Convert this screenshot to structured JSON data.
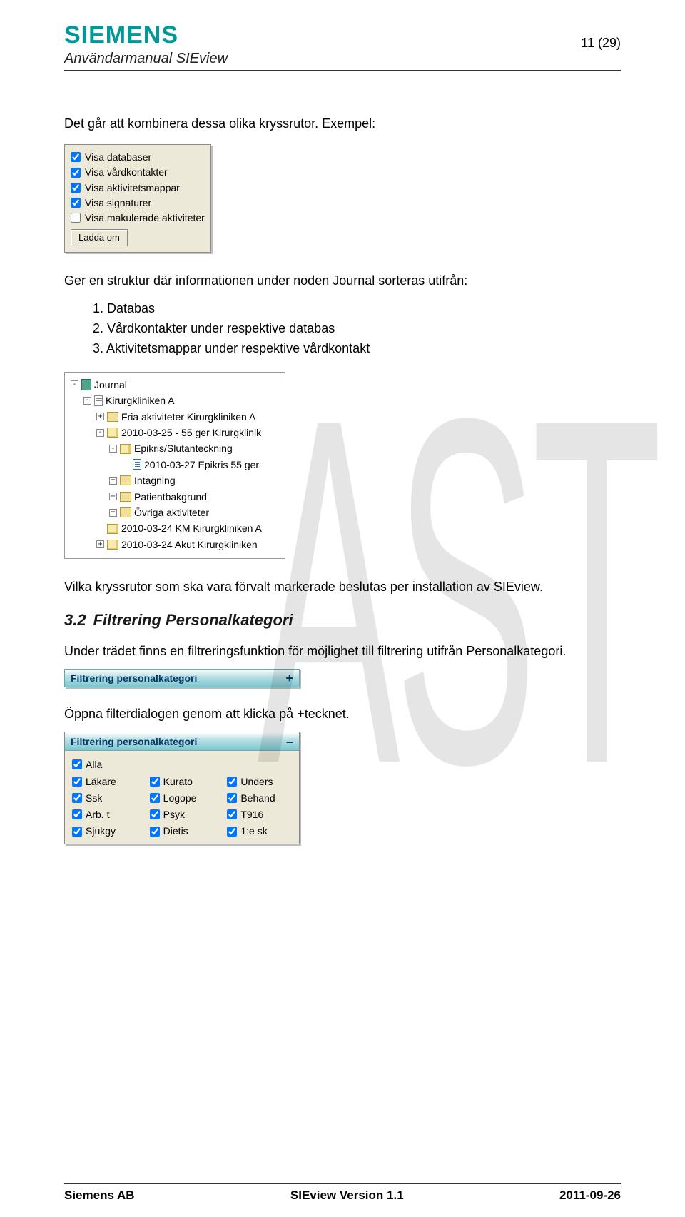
{
  "header": {
    "logo": "SIEMENS",
    "manual_title": "Användarmanual SIEview",
    "page_num": "11 (29)"
  },
  "watermark": "AST",
  "body": {
    "p1": "Det går att kombinera dessa olika kryssrutor. Exempel:",
    "checkbox_panel": {
      "opts": [
        {
          "label": "Visa databaser",
          "checked": true
        },
        {
          "label": "Visa vårdkontakter",
          "checked": true
        },
        {
          "label": "Visa aktivitetsmappar",
          "checked": true
        },
        {
          "label": "Visa signaturer",
          "checked": true
        },
        {
          "label": "Visa makulerade aktiviteter",
          "checked": false
        }
      ],
      "button": "Ladda om"
    },
    "p2": "Ger en struktur där informationen under noden Journal sorteras utifrån:",
    "list": [
      "1. Databas",
      "2. Vårdkontakter under respektive databas",
      "3. Aktivitetsmappar under respektive vårdkontakt"
    ],
    "tree": [
      {
        "pad": 1,
        "exp": "-",
        "ico": "jr",
        "label": "Journal"
      },
      {
        "pad": 2,
        "exp": "-",
        "ico": "db",
        "label": "Kirurgkliniken A"
      },
      {
        "pad": 3,
        "exp": "+",
        "ico": "fc",
        "label": "Fria aktiviteter Kirurgkliniken A"
      },
      {
        "pad": 3,
        "exp": "-",
        "ico": "fo",
        "label": "2010-03-25 - 55 ger Kirurgklinik"
      },
      {
        "pad": 4,
        "exp": "-",
        "ico": "fo",
        "label": "Epikris/Slutanteckning"
      },
      {
        "pad": 5,
        "exp": "",
        "ico": "doc",
        "label": "2010-03-27 Epikris 55 ger"
      },
      {
        "pad": 4,
        "exp": "+",
        "ico": "fc",
        "label": "Intagning"
      },
      {
        "pad": 4,
        "exp": "+",
        "ico": "fc",
        "label": "Patientbakgrund"
      },
      {
        "pad": 4,
        "exp": "+",
        "ico": "fc",
        "label": "Övriga aktiviteter"
      },
      {
        "pad": 3,
        "exp": "",
        "ico": "fo",
        "label": "2010-03-24 KM Kirurgkliniken A"
      },
      {
        "pad": 3,
        "exp": "+",
        "ico": "fo",
        "label": "2010-03-24 Akut Kirurgkliniken"
      }
    ],
    "p3": "Vilka kryssrutor som ska vara förvalt markerade beslutas per installation av SIEview.",
    "section": {
      "num": "3.2",
      "title": "Filtrering Personalkategori"
    },
    "p4": "Under trädet finns en filtreringsfunktion för möjlighet till filtrering utifrån Personalkategori.",
    "filterbar_collapsed": {
      "label": "Filtrering personalkategori",
      "toggle": "+"
    },
    "p5": "Öppna filterdialogen genom att klicka på +tecknet.",
    "filterbar_expanded": {
      "label": "Filtrering personalkategori",
      "toggle": "–"
    },
    "filter_options": {
      "all": "Alla",
      "rows": [
        [
          "Läkare",
          "Kurato",
          "Unders"
        ],
        [
          "Ssk",
          "Logope",
          "Behand"
        ],
        [
          "Arb. t",
          "Psyk",
          "T916"
        ],
        [
          "Sjukgy",
          "Dietis",
          "1:e sk"
        ]
      ]
    }
  },
  "footer": {
    "left": "Siemens AB",
    "center": "SIEview Version 1.1",
    "right": "2011-09-26"
  }
}
